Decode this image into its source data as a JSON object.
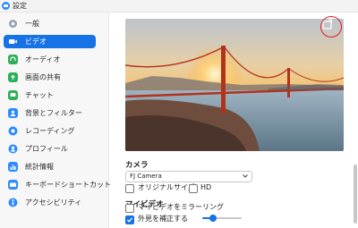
{
  "window": {
    "title": "設定"
  },
  "sidebar": {
    "items": [
      {
        "label": "一般",
        "icon": "gear-icon",
        "color": "#9aa0a6"
      },
      {
        "label": "ビデオ",
        "icon": "video-camera-icon",
        "color": "#ffffff",
        "active": true
      },
      {
        "label": "オーディオ",
        "icon": "headphones-icon",
        "color": "#2fae5a"
      },
      {
        "label": "画面の共有",
        "icon": "share-screen-icon",
        "color": "#2fae5a"
      },
      {
        "label": "チャット",
        "icon": "chat-bubble-icon",
        "color": "#2fae5a"
      },
      {
        "label": "背景とフィルター",
        "icon": "background-person-icon",
        "color": "#2d8cff"
      },
      {
        "label": "レコーディング",
        "icon": "record-icon",
        "color": "#2d8cff"
      },
      {
        "label": "プロフィール",
        "icon": "profile-icon",
        "color": "#2d8cff"
      },
      {
        "label": "統計情報",
        "icon": "statistics-icon",
        "color": "#2d8cff"
      },
      {
        "label": "キーボードショートカット",
        "icon": "keyboard-icon",
        "color": "#2d8cff"
      },
      {
        "label": "アクセシビリティ",
        "icon": "accessibility-icon",
        "color": "#2d8cff"
      }
    ]
  },
  "preview": {
    "image": "golden-gate-bridge-sunset",
    "rotate_icon": "rotate-camera-icon"
  },
  "camera": {
    "heading": "カメラ",
    "selected": "FJ Camera",
    "original_size_label": "オリジナルサイズ",
    "original_size_checked": false,
    "hd_label": "HD",
    "hd_checked": false
  },
  "my_video": {
    "heading": "マイビデオ",
    "mirror_label": "マイビデオをミラーリング",
    "mirror_checked": false,
    "touch_up_label": "外見を補正する",
    "touch_up_checked": true,
    "touch_up_level": 0.28
  },
  "colors": {
    "accent": "#1673e6",
    "highlight_circle": "#e01b2f"
  }
}
